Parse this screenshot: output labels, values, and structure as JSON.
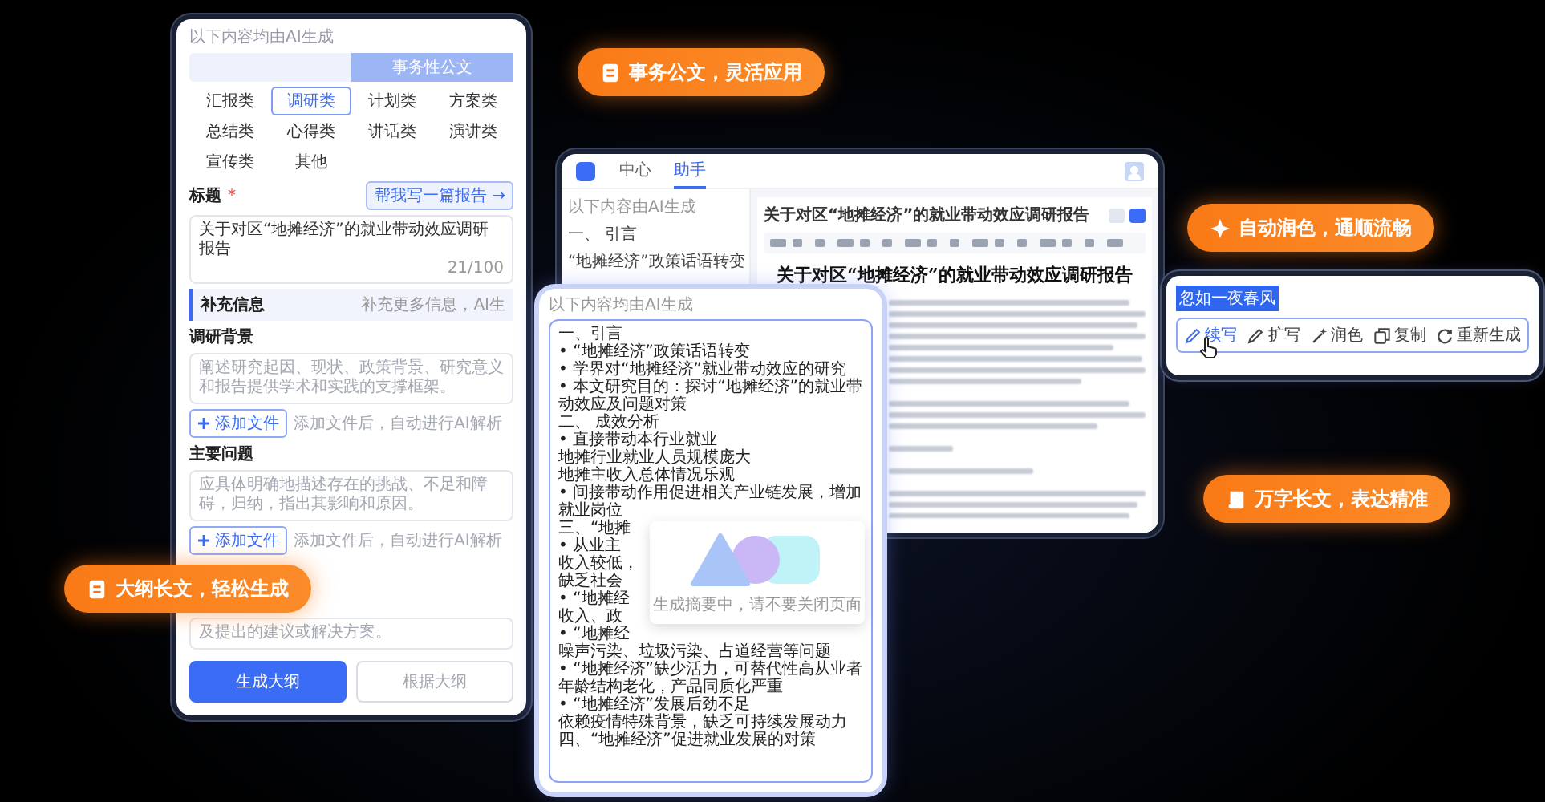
{
  "main_window": {
    "nav_tabs": [
      {
        "label": "中心",
        "selected": false
      },
      {
        "label": "助手",
        "selected": true
      }
    ],
    "outline": {
      "notice": "以下内容由AI生成",
      "items": [
        "一、 引言",
        "“地摊经济”政策话语转变"
      ]
    },
    "document": {
      "header_title": "关于对区“地摊经济”的就业带动效应调研报告",
      "title": "关于对区“地摊经济”的就业带动效应调研报告"
    }
  },
  "form_panel": {
    "notice": "以下内容均由AI生成",
    "tabs": [
      {
        "label": "事务性公文",
        "selected": true
      }
    ],
    "categories": [
      {
        "label": "汇报类",
        "selected": false
      },
      {
        "label": "调研类",
        "selected": true
      },
      {
        "label": "计划类",
        "selected": false
      },
      {
        "label": "方案类",
        "selected": false
      },
      {
        "label": "总结类",
        "selected": false
      },
      {
        "label": "心得类",
        "selected": false
      },
      {
        "label": "讲话类",
        "selected": false
      },
      {
        "label": "演讲类",
        "selected": false
      },
      {
        "label": "宣传类",
        "selected": false
      },
      {
        "label": "其他",
        "selected": false
      }
    ],
    "title_field": {
      "label": "标题",
      "required_mark": "*",
      "helper_button": "帮我写一篇报告 →",
      "value": "关于对区“地摊经济”的就业带动效应调研报告",
      "count": "21/100"
    },
    "supplement": {
      "heading": "补充信息",
      "hint": "补充更多信息，AI生",
      "fields": [
        {
          "label": "调研背景",
          "placeholder": "阐述研究起因、现状、政策背景、研究意义和报告提供学术和实践的支撑框架。",
          "add_button": "添加文件",
          "add_hint": "添加文件后，自动进行AI解析"
        },
        {
          "label": "主要问题",
          "placeholder": "应具体明确地描述存在的挑战、不足和障碍，归纳，指出其影响和原因。",
          "add_button": "添加文件",
          "add_hint": "添加文件后，自动进行AI解析"
        }
      ],
      "covered_placeholder": "及提出的建议或解决方案。"
    },
    "buttons": [
      "生成大纲",
      "根据大纲"
    ]
  },
  "outline_panel": {
    "notice": "以下内容均由AI生成",
    "lines": [
      "一、引言",
      "• “地摊经济”政策话语转变",
      "• 学界对“地摊经济”就业带动效应的研究",
      "• 本文研究目的：探讨“地摊经济”的就业带动效应及问题对策",
      "二、 成效分析",
      "• 直接带动本行业就业",
      "地摊行业就业人员规模庞大",
      "地摊主收入总体情况乐观",
      "• 间接带动作用促进相关产业链发展，增加就业岗位",
      "三、“地摊",
      "• 从业主",
      "收入较低，",
      "缺乏社会",
      "• “地摊经",
      "收入、政",
      "• “地摊经",
      "噪声污染、垃圾污染、占道经营等问题",
      "• “地摊经济”缺少活力，可替代性高从业者年龄结构老化，产品同质化严重",
      "• “地摊经济”发展后劲不足",
      "依赖疫情特殊背景，缺乏可持续发展动力",
      "四、“地摊经济”促进就业发展的对策"
    ],
    "loading_card": {
      "message": "生成摘要中，请不要关闭页面"
    }
  },
  "rewrite_popup": {
    "selected_text": "忽如一夜春风",
    "actions": [
      {
        "label": "续写",
        "selected": true
      },
      {
        "label": "扩写",
        "selected": false
      },
      {
        "label": "润色",
        "selected": false
      },
      {
        "label": "复制",
        "selected": false
      },
      {
        "label": "重新生成",
        "selected": false
      }
    ]
  },
  "badges": [
    "事务公文，灵活应用",
    "自动润色，通顺流畅",
    "万字长文，表达精准",
    "大纲长文，轻松生成"
  ]
}
